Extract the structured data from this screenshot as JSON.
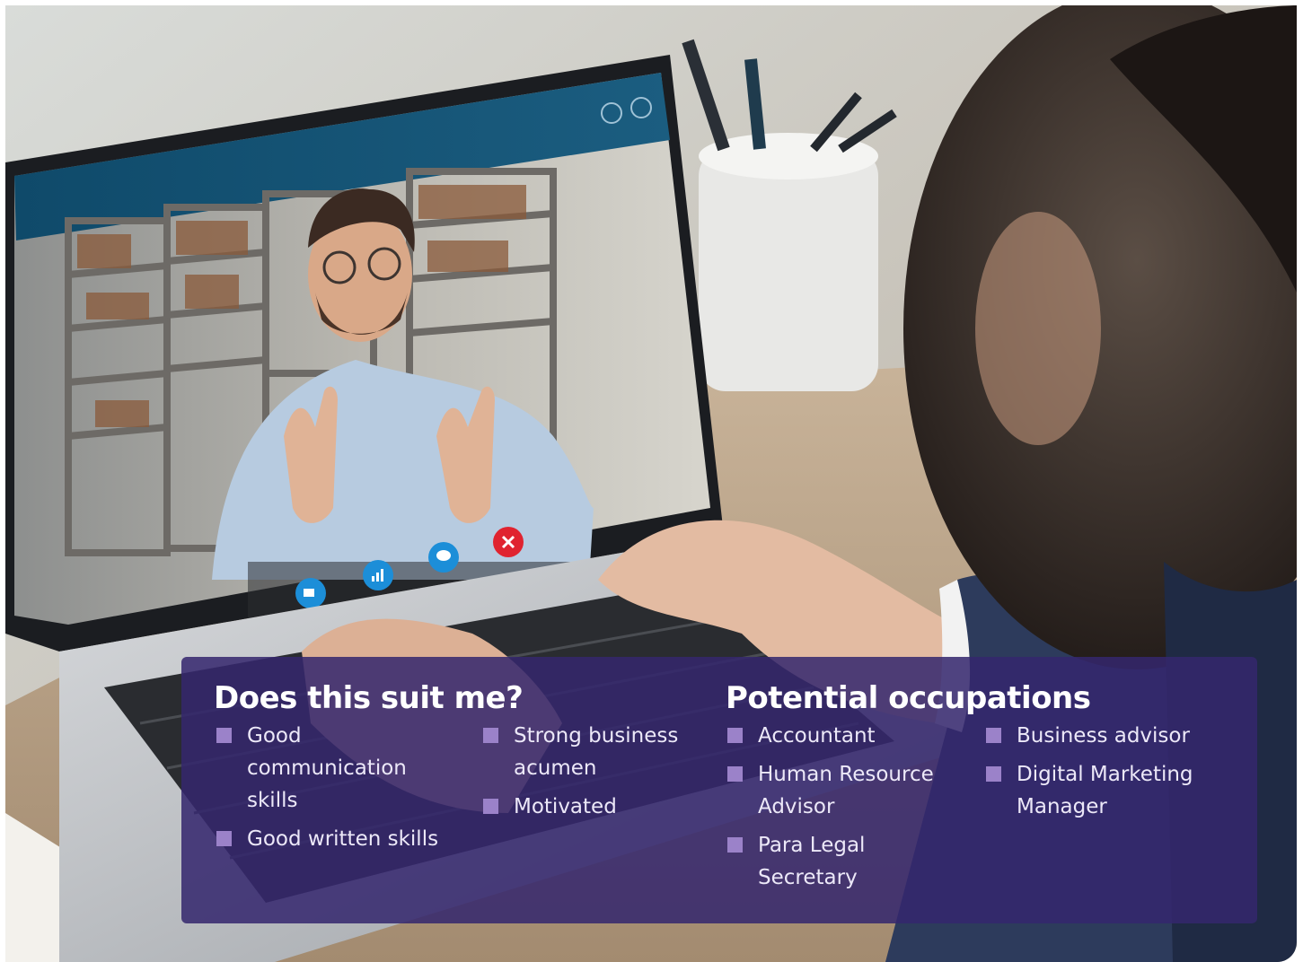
{
  "suit": {
    "title": "Does this suit me?",
    "col1": [
      "Good communication skills",
      "Good written skills"
    ],
    "col2": [
      "Strong business acumen",
      "Motivated"
    ]
  },
  "occupations": {
    "title": "Potential occupations",
    "col1": [
      "Accountant",
      "Human Resource Advisor",
      "Para Legal Secretary"
    ],
    "col2": [
      "Business advisor",
      "Digital Marketing Manager"
    ]
  },
  "colors": {
    "panel": "#34266e",
    "bullet": "#9b82c9",
    "call_red": "#e0232f",
    "call_blue": "#1c8ed8"
  },
  "photo": {
    "icons": [
      "minimize-icon",
      "expand-icon",
      "video-camera-icon",
      "signal-icon",
      "chat-bubble-icon",
      "end-call-icon"
    ]
  }
}
